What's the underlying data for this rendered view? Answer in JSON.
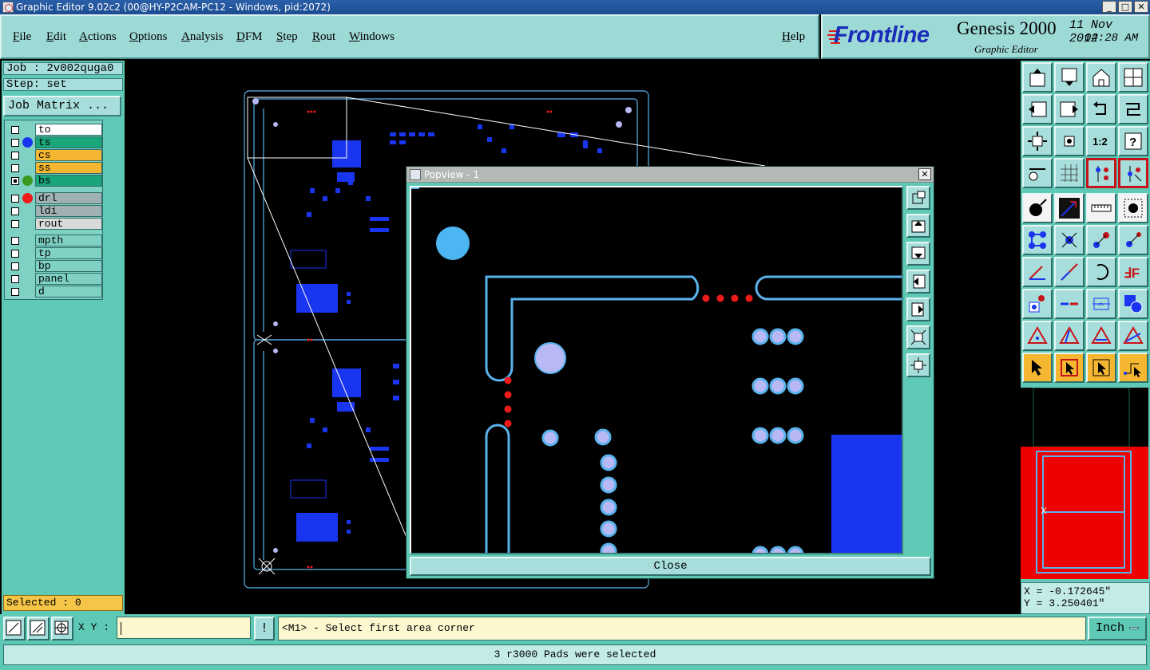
{
  "window": {
    "title": "Graphic Editor 9.02c2 (00@HY-P2CAM-PC12 - Windows, pid:2072)"
  },
  "menu": {
    "items": [
      "File",
      "Edit",
      "Actions",
      "Options",
      "Analysis",
      "DFM",
      "Step",
      "Rout",
      "Windows"
    ],
    "help": "Help"
  },
  "brand": {
    "logo": "Frontline",
    "product": "Genesis 2000",
    "subtitle": "Graphic Editor",
    "date": "11 Nov 2012",
    "time": "04:28 AM"
  },
  "job": {
    "job_label": "Job : 2v002quga0",
    "step_label": "Step: set",
    "matrix_button": "Job Matrix ..."
  },
  "layers": [
    {
      "name": "to",
      "color": "#ffffff",
      "dot": ""
    },
    {
      "name": "ts",
      "color": "#1aa57a",
      "dot": "#1a35f0"
    },
    {
      "name": "cs",
      "color": "#f5b731",
      "dot": ""
    },
    {
      "name": "ss",
      "color": "#f5b731",
      "dot": ""
    },
    {
      "name": "bs",
      "color": "#1aa57a",
      "dot": "#3a9a20"
    },
    {
      "name": "drl",
      "color": "#9fb1b3",
      "dot": "#ef1b1b"
    },
    {
      "name": "ldi",
      "color": "#9fb1b3",
      "dot": ""
    },
    {
      "name": "rout",
      "color": "#d9d9d9",
      "dot": ""
    },
    {
      "name": "mpth",
      "color": "#7fd1c4",
      "dot": ""
    },
    {
      "name": "tp",
      "color": "#7fd1c4",
      "dot": ""
    },
    {
      "name": "bp",
      "color": "#7fd1c4",
      "dot": ""
    },
    {
      "name": "panel",
      "color": "#7fd1c4",
      "dot": ""
    },
    {
      "name": "d",
      "color": "#7fd1c4",
      "dot": ""
    }
  ],
  "selected": "Selected : 0",
  "popview": {
    "title": "Popview - 1",
    "close_label": "Close"
  },
  "coords": {
    "x": "X = -0.172645\"",
    "y": "Y = 3.250401\""
  },
  "bottom": {
    "xy_label": "X Y :",
    "xy_value": "",
    "excl": "!",
    "prompt": "<M1> - Select first area corner",
    "units": "Inch"
  },
  "status": "3 r3000 Pads were selected",
  "colors": {
    "panel": "#5ec9b5",
    "menubar": "#9dd9d5",
    "pcb_trace": "#5ab2ec",
    "pcb_pad": "#1a35f0",
    "drill": "#ef1b1b",
    "hole_pad": "#b8b8f4"
  }
}
